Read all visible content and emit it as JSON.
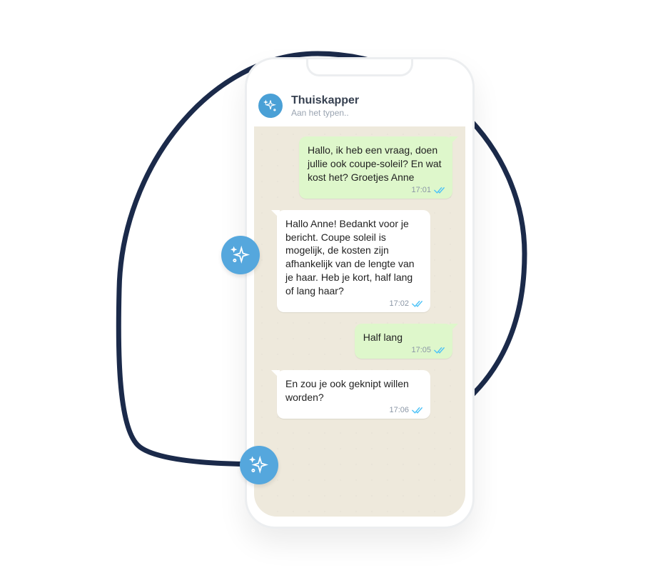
{
  "header": {
    "contact_name": "Thuiskapper",
    "status": "Aan het typen.."
  },
  "colors": {
    "accent": "#55a7dd",
    "sent_bubble": "#def7cb",
    "recv_bubble": "#ffffff",
    "chat_bg": "#eee9dc",
    "tick": "#4fc3f7",
    "shape_stroke": "#1b2a4a"
  },
  "icons": {
    "sparkle": "sparkle-icon",
    "read_ticks": "double-check-icon"
  },
  "messages": [
    {
      "direction": "sent",
      "text": "Hallo, ik heb een vraag, doen jullie ook coupe-soleil? En wat kost het? Groetjes Anne",
      "time": "17:01",
      "read": true
    },
    {
      "direction": "recv",
      "text": "Hallo Anne! Bedankt voor je bericht. Coupe soleil is mogelijk, de kosten zijn afhankelijk van de lengte van je haar. Heb je kort, half lang of lang haar?",
      "time": "17:02",
      "read": true
    },
    {
      "direction": "sent",
      "text": "Half lang",
      "time": "17:05",
      "read": true
    },
    {
      "direction": "recv",
      "text": "En zou je ook geknipt willen worden?",
      "time": "17:06",
      "read": true
    }
  ]
}
